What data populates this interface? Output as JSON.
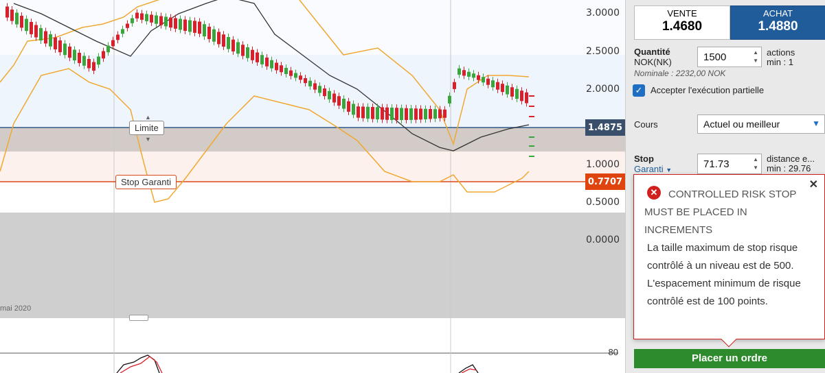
{
  "chart": {
    "axis_labels": [
      "3.0000",
      "2.5000",
      "2.0000",
      "1.0000",
      "0.5000",
      "0.0000"
    ],
    "date_label": "mai 2020",
    "limit_tag": "Limite",
    "stop_tag": "Stop Garanti",
    "current_price_tag": "1.4875",
    "stop_price_tag": "0.7707",
    "oscillator_level": "80",
    "colors": {
      "up": "#3aa53a",
      "down": "#d9202a",
      "band": "#f0a830",
      "ma": "#333333",
      "stop_line": "#d94a1a",
      "price_line": "#2f5a8a",
      "current_tag": "#3a4f6b",
      "stop_tag_bg": "#e0440e"
    }
  },
  "panel": {
    "sell": {
      "label": "VENTE",
      "price": "1.4680"
    },
    "buy": {
      "label": "ACHAT",
      "price": "1.4880"
    },
    "quantity": {
      "label": "Quantité",
      "currency": "NOK(NK)",
      "value": "1500",
      "unit": "actions",
      "min": "min : 1",
      "nominal": "Nominale : 2232,00 NOK"
    },
    "partial": {
      "label": "Accepter l'exécution partielle",
      "checked": true
    },
    "price_type": {
      "label": "Cours",
      "value": "Actuel ou meilleur"
    },
    "stop": {
      "label": "Stop",
      "type": "Garanti",
      "value": "71.73",
      "distance": "distance e...",
      "min": "min : 29.76"
    },
    "error": {
      "title": "CONTROLLED RISK STOP MUST BE PLACED IN INCREMENTS",
      "body": "La taille maximum de stop risque contrôlé à un niveau est de 500. L'espacement minimum de risque contrôlé est de 100 points."
    },
    "order_button": "Placer un ordre"
  }
}
